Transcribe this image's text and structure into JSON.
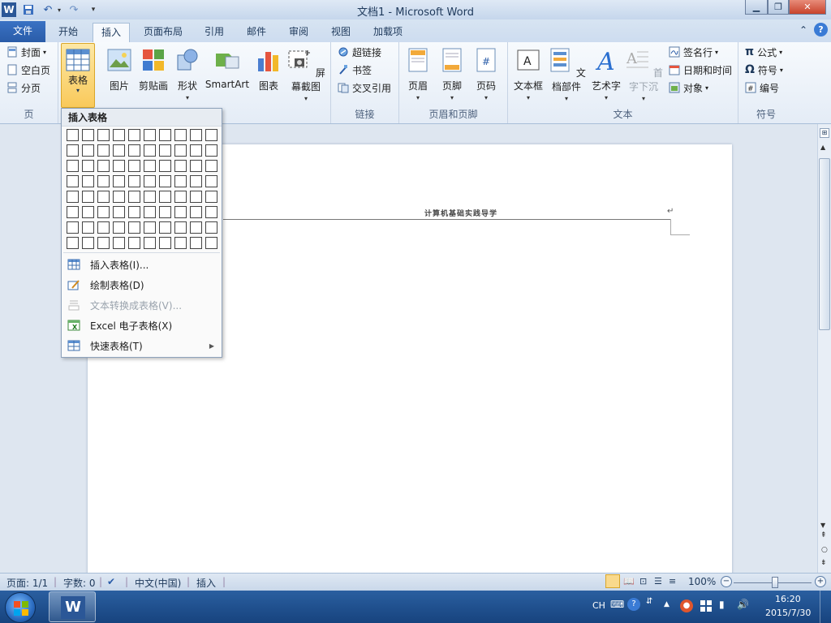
{
  "window": {
    "title": "文档1 - Microsoft Word"
  },
  "qat": {
    "word_icon": "W",
    "save_icon": "save-icon",
    "undo_icon": "undo-icon",
    "redo_icon": "redo-icon"
  },
  "tabs": [
    {
      "label": "文件"
    },
    {
      "label": "开始"
    },
    {
      "label": "插入"
    },
    {
      "label": "页面布局"
    },
    {
      "label": "引用"
    },
    {
      "label": "邮件"
    },
    {
      "label": "审阅"
    },
    {
      "label": "视图"
    },
    {
      "label": "加载项"
    }
  ],
  "ribbon": {
    "page_group": {
      "label": "页",
      "cover": "封面",
      "blank": "空白页",
      "break": "分页"
    },
    "table": {
      "label": "表格"
    },
    "illustrations": {
      "picture": "图片",
      "clipart": "剪贴画",
      "shapes": "形状",
      "smartart": "SmartArt",
      "chart": "图表",
      "screenshot": "屏幕截图"
    },
    "links_group": {
      "label": "链接",
      "hyperlink": "超链接",
      "bookmark": "书签",
      "crossref": "交叉引用"
    },
    "header_footer_group": {
      "label": "页眉和页脚",
      "header": "页眉",
      "footer": "页脚",
      "pagenum": "页码"
    },
    "text_group": {
      "label": "文本",
      "textbox": "文本框",
      "parts": "文档部件",
      "wordart": "艺术字",
      "dropcap": "首字下沉",
      "signature": "签名行",
      "datetime": "日期和时间",
      "object": "对象"
    },
    "symbols_group": {
      "label": "符号",
      "equation": "公式",
      "symbol": "符号",
      "number": "编号"
    }
  },
  "dropdown": {
    "header": "插入表格",
    "items": [
      {
        "label": "插入表格(I)..."
      },
      {
        "label": "绘制表格(D)"
      },
      {
        "label": "文本转换成表格(V)..."
      },
      {
        "label": "Excel 电子表格(X)"
      },
      {
        "label": "快速表格(T)"
      }
    ]
  },
  "document": {
    "header_text": "计算机基础实践导学",
    "para_mark": "↵"
  },
  "status": {
    "page": "页面: 1/1",
    "words": "字数: 0",
    "lang": "中文(中国)",
    "mode": "插入",
    "zoom": "100%"
  },
  "taskbar": {
    "ime": "CH",
    "time": "16:20",
    "date": "2015/7/30"
  },
  "colors": {
    "file_tab": "#2a5ca8",
    "ribbon": "#eef3fa",
    "taskbar": "#1d4b8c"
  }
}
